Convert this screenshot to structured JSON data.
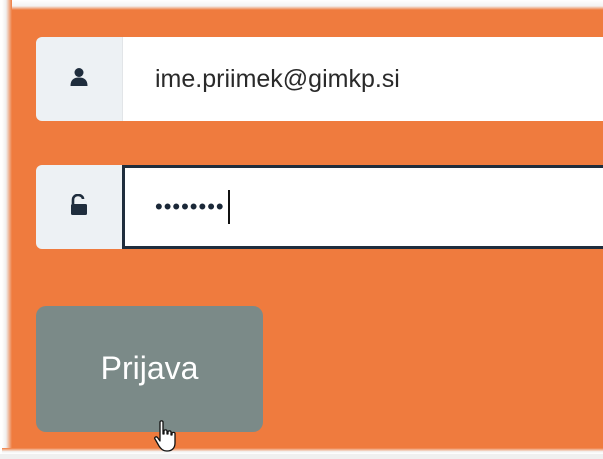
{
  "form": {
    "username": {
      "icon": "user-icon",
      "value": "ime.priimek@gimkp.si"
    },
    "password": {
      "icon": "unlock-icon",
      "masked_value": "••••••••"
    },
    "submit_label": "Prijava"
  },
  "colors": {
    "background": "#ef7b3e",
    "button": "#7b8a88",
    "addon": "#edf1f4",
    "focus_border": "#1f2d3d"
  }
}
